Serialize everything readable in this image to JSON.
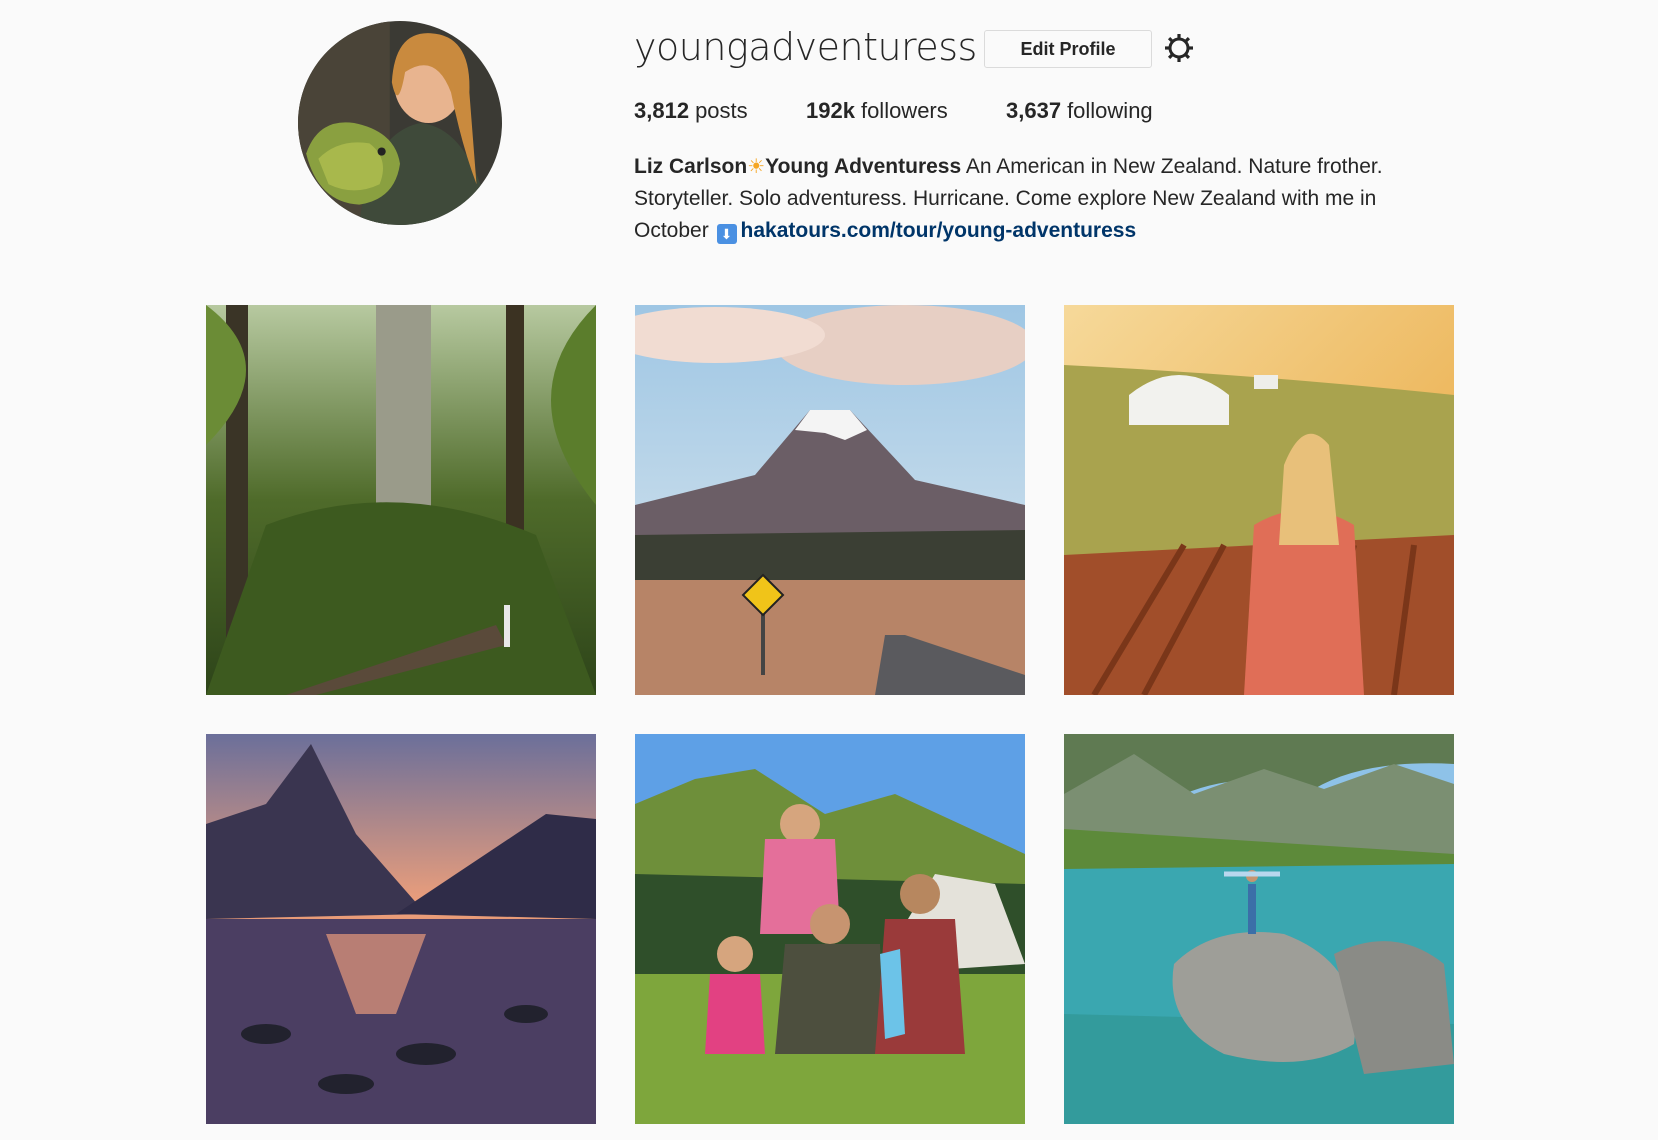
{
  "profile": {
    "username": "youngadventuress",
    "edit_profile_label": "Edit Profile",
    "settings_icon": "gear-icon",
    "avatar_icon": "profile-photo"
  },
  "stats": {
    "posts_count": "3,812",
    "posts_label": "posts",
    "followers_count": "192k",
    "followers_label": "followers",
    "following_count": "3,637",
    "following_label": "following"
  },
  "bio": {
    "full_name_part1": "Liz Carlson",
    "sun_emoji": "☀",
    "full_name_part2": "Young Adventuress",
    "text": " An American in New Zealand. Nature frother. Storyteller. Solo adventuress. Hurricane. Come explore New Zealand with me in October ",
    "arrow_emoji": "⬇",
    "link": "hakatours.com/tour/young-adventuress"
  },
  "posts": [
    {
      "name": "post-forest"
    },
    {
      "name": "post-volcano-road"
    },
    {
      "name": "post-yurt-swing"
    },
    {
      "name": "post-fiord-sunset"
    },
    {
      "name": "post-family"
    },
    {
      "name": "post-lake"
    }
  ],
  "colors": {
    "link": "#003569",
    "text": "#262626",
    "border": "#dbdbdb",
    "background": "#fafafa"
  }
}
